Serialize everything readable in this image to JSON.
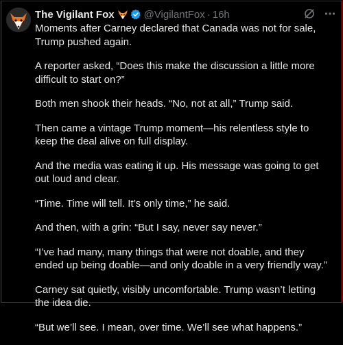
{
  "tweet": {
    "author_name": "The Vigilant Fox",
    "handle": "@VigilantFox",
    "separator": "·",
    "time": "16h",
    "paragraphs": [
      "Moments after Carney declared that Canada was not for sale, Trump pushed again.",
      "A reporter asked, “Does this make the discussion a little more difficult to start on?”",
      "Both men shook their heads. “No, not at all,” Trump said.",
      "Then came a vintage Trump moment—his relentless style to keep the deal alive on full display.",
      "And the media was eating it up. His message was going to get out loud and clear.",
      "“Time. Time will tell. It’s only time,” he said.",
      "And then, with a grin: “But I say, never say never.”",
      "“I’ve had many, many things that were not doable, and they ended up being doable—and only doable in a very friendly way.”",
      "Carney sat quietly, visibly uncomfortable. Trump wasn’t letting the idea die.",
      "“But we’ll see. I mean, over time. We’ll see what happens.”"
    ]
  },
  "icons": {
    "avatar": "fox-avatar-icon",
    "name_emoji": "fox-emoji-icon",
    "verified": "verified-badge-icon",
    "grok": "grok-icon",
    "more": "more-icon"
  },
  "colors": {
    "background": "#000000",
    "text": "#e7e9ea",
    "muted": "#71767b",
    "verified": "#1d9bf0"
  }
}
